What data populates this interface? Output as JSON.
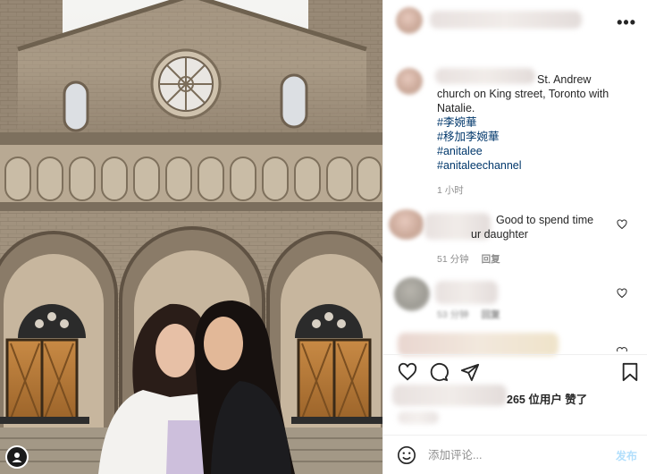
{
  "caption": {
    "text_start": "St. Andrew",
    "text_rest": "church on King street, Toronto with Natalie.",
    "hashtags": [
      "#李婉華",
      "#移加李婉華",
      "#anitalee",
      "#anitaleechannel"
    ],
    "time": "1 小时"
  },
  "comments": [
    {
      "line1": "Good to spend time",
      "line2": "ur daughter",
      "time": "51 分钟",
      "reply_label": "回复"
    },
    {
      "time": "53 分钟",
      "reply_label": "回复"
    }
  ],
  "likes": {
    "text": "265 位用户 赞了"
  },
  "add_comment": {
    "placeholder": "添加评论...",
    "post_label": "发布"
  },
  "icons": {
    "more": "more-horizontal-icon",
    "like": "heart-icon",
    "comment": "comment-bubble-icon",
    "share": "paper-plane-icon",
    "save": "bookmark-icon",
    "emoji": "smiley-icon"
  },
  "colors": {
    "hashtag": "#00376b",
    "meta": "#8e8e8e",
    "post_button": "#b2dffc",
    "border": "#efefef"
  }
}
